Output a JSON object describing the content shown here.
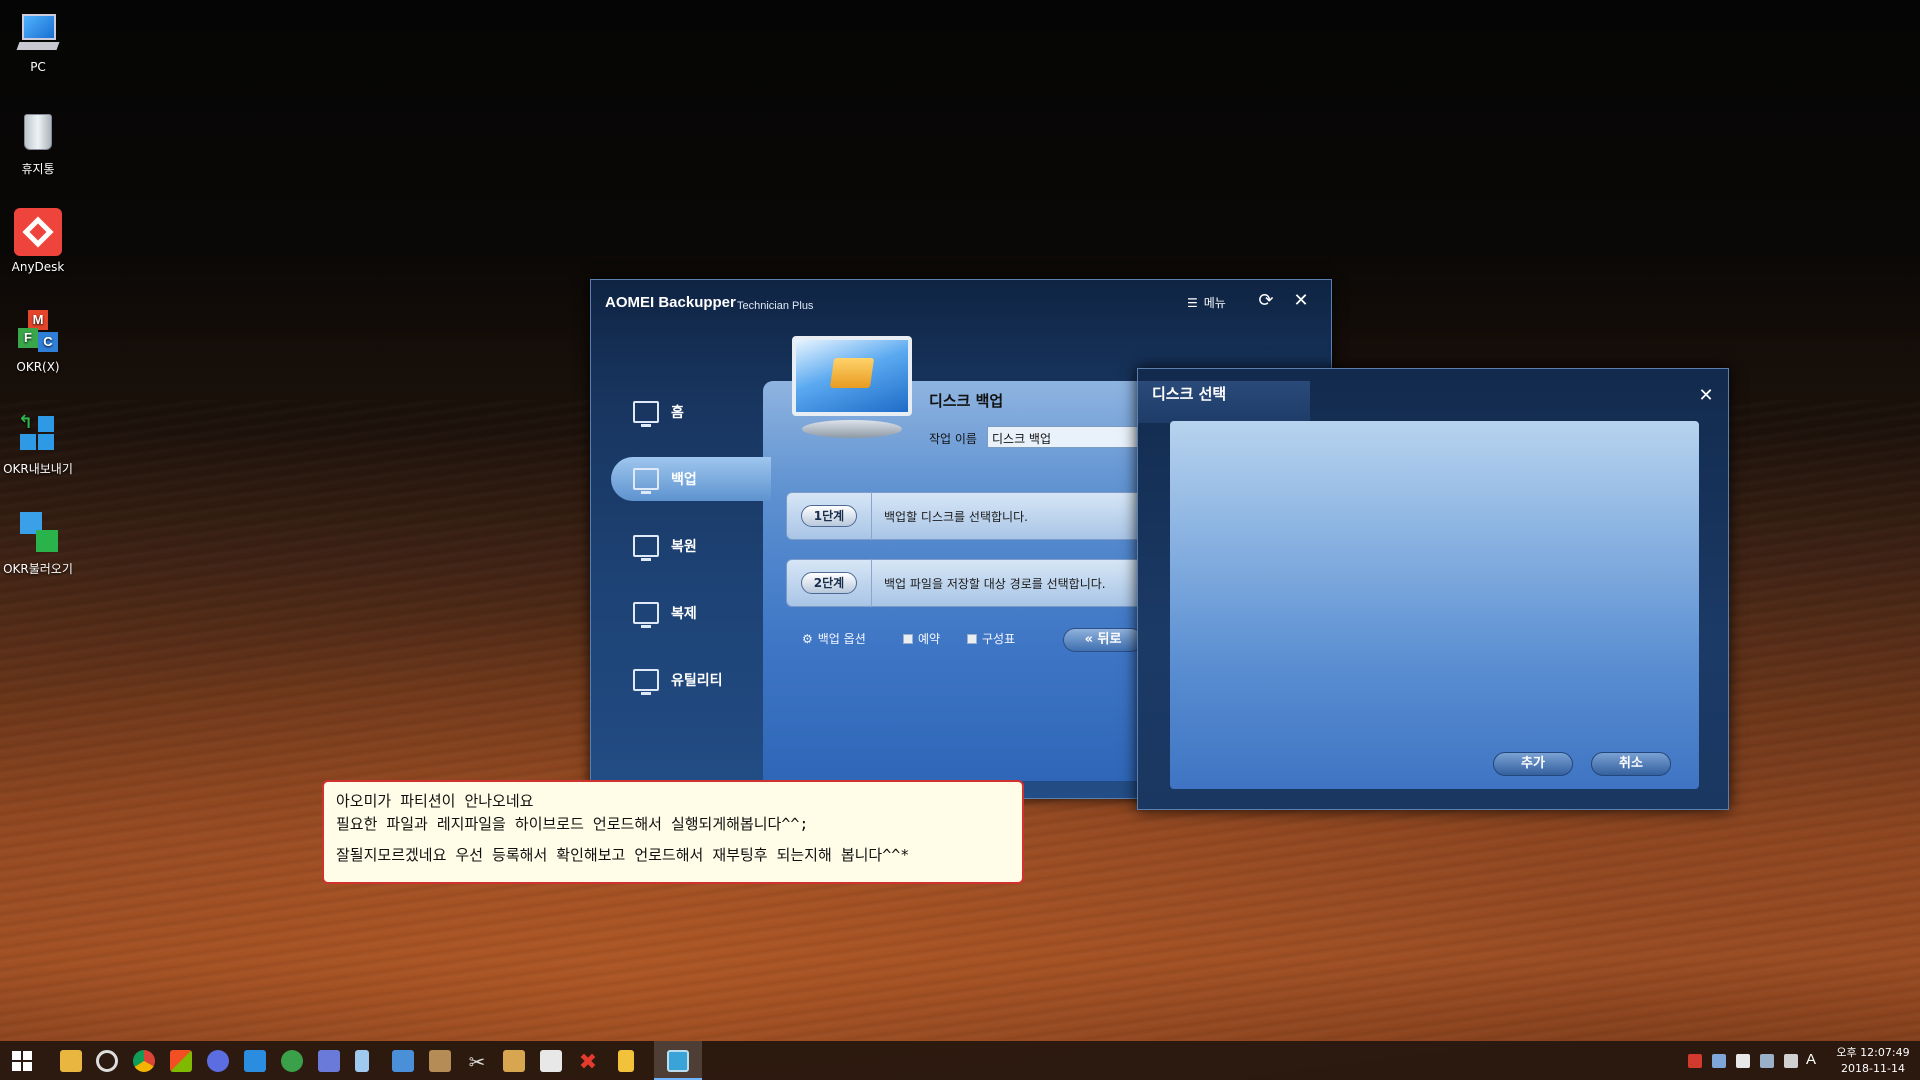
{
  "desktop": {
    "icons": [
      {
        "label": "PC"
      },
      {
        "label": "휴지통"
      },
      {
        "label": "AnyDesk"
      },
      {
        "label": "OKR(X)"
      },
      {
        "label": "OKR내보내기"
      },
      {
        "label": "OKR불러오기"
      }
    ]
  },
  "app": {
    "title": "AOMEI Backupper",
    "edition": "Technician Plus",
    "menu_label": "메뉴",
    "sidebar": [
      {
        "label": "홈"
      },
      {
        "label": "백업"
      },
      {
        "label": "복원"
      },
      {
        "label": "복제"
      },
      {
        "label": "유틸리티"
      }
    ],
    "task_title": "디스크 백업",
    "task_name_label": "작업 이름",
    "task_name_value": "디스크 백업",
    "steps": [
      {
        "badge": "1단계",
        "text": "백업할 디스크를 선택합니다."
      },
      {
        "badge": "2단계",
        "text": "백업 파일을 저장할 대상 경로를 선택합니다."
      }
    ],
    "options": {
      "backup_options": "백업 옵션",
      "schedule": "예약",
      "scheme": "구성표"
    },
    "back_button": "뒤로"
  },
  "dialog": {
    "title": "디스크 선택",
    "add_button": "추가",
    "cancel_button": "취소"
  },
  "note": {
    "line1": "아오미가 파티션이 안나오네요",
    "line2": "필요한 파일과 레지파일을 하이브로드 언로드해서 실행되게해봅니다^^;",
    "line3": "잘될지모르겠네요 우선 등록해서 확인해보고 언로드해서 재부팅후 되는지해 봅니다^^*"
  },
  "taskbar": {
    "ime": "A",
    "time": "오후 12:07:49",
    "date": "2018-11-14"
  },
  "colors": {
    "note_border": "#d2322d",
    "note_bg": "#fffde8",
    "anydesk": "#ef443b"
  }
}
